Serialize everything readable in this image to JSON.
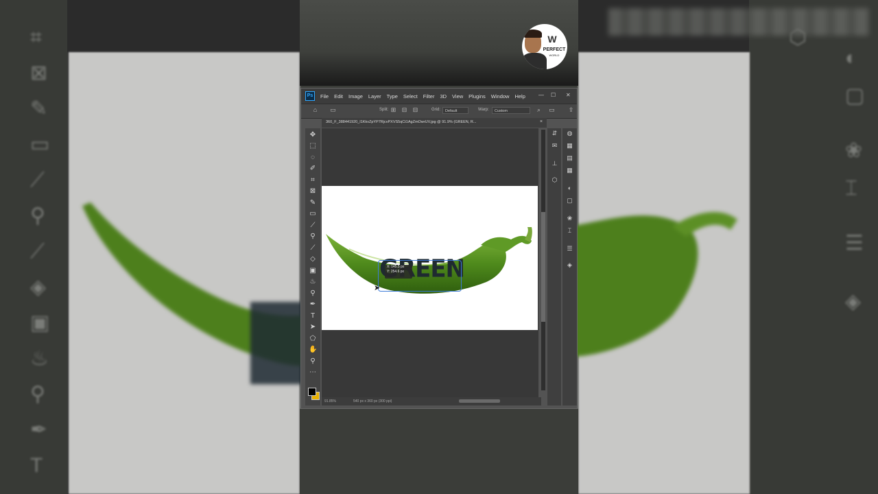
{
  "app": {
    "menu": [
      "File",
      "Edit",
      "Image",
      "Layer",
      "Type",
      "Select",
      "Filter",
      "3D",
      "View",
      "Plugins",
      "Window",
      "Help"
    ],
    "window_controls": {
      "minimize": "—",
      "maximize": "☐",
      "close": "✕"
    }
  },
  "options_bar": {
    "split_label": "Split:",
    "grid_label": "Grid:",
    "grid_value": "Default",
    "warp_label": "Warp:",
    "warp_value": "Custom"
  },
  "document": {
    "tab_title": "360_F_388441920_I1KkvZpYP7RjcvPXVS5qCt1AgZmOwrUV.jpg @ 91.9% (GREEN, R...",
    "tab_close": "×",
    "layer_text": "GREEN",
    "coord_x": "X: 145.5 px",
    "coord_y": "Y: 254.6 px"
  },
  "status": {
    "zoom": "91.85%",
    "size": "540 px x 360 px (300 ppi)"
  },
  "watermark": {
    "brand": "PERFECT",
    "sub": "WORLD"
  },
  "colors": {
    "foreground": "#000000",
    "background": "#e8b000",
    "pepper": "#4f8a1c",
    "selection": "#3d7bd8"
  },
  "icons": {
    "tools": [
      "move-icon",
      "marquee-icon",
      "lasso-icon",
      "quick-select-icon",
      "crop-icon",
      "frame-icon",
      "eyedropper-icon",
      "spot-heal-icon",
      "brush-icon",
      "stamp-icon",
      "history-brush-icon",
      "eraser-icon",
      "gradient-icon",
      "blur-icon",
      "dodge-icon",
      "pen-icon",
      "type-icon",
      "path-select-icon",
      "shape-icon",
      "hand-icon",
      "zoom-icon",
      "more-tools-icon"
    ]
  }
}
